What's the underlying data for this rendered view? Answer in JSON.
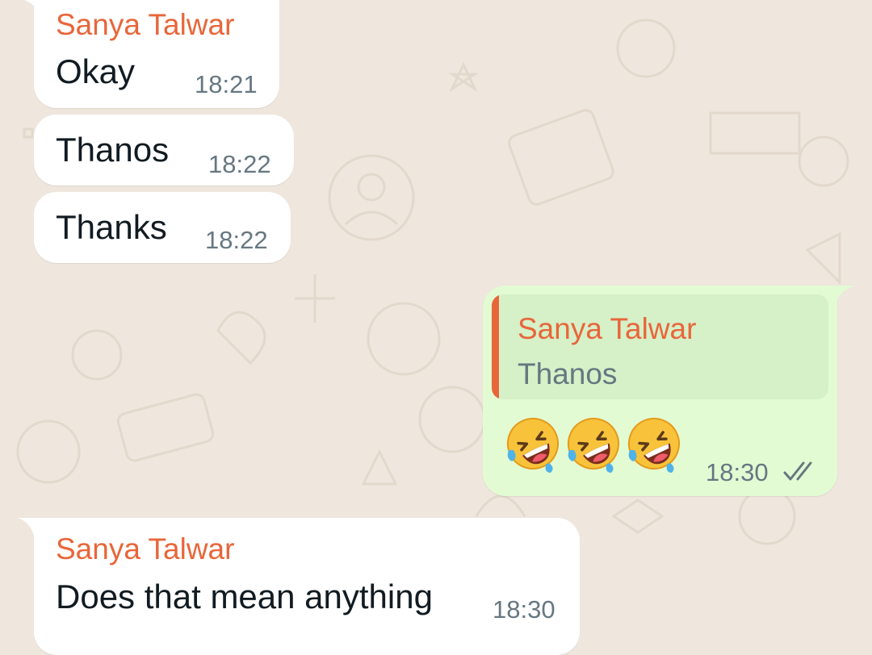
{
  "messages": [
    {
      "id": "m1",
      "direction": "incoming",
      "sender": "Sanya Talwar",
      "text": "Okay",
      "time": "18:21"
    },
    {
      "id": "m2",
      "direction": "incoming",
      "text": "Thanos",
      "time": "18:22"
    },
    {
      "id": "m3",
      "direction": "incoming",
      "text": "Thanks",
      "time": "18:22"
    },
    {
      "id": "m4",
      "direction": "outgoing",
      "quote": {
        "sender": "Sanya Talwar",
        "text": "Thanos"
      },
      "emojis": [
        "rolling-on-floor-laughing",
        "rolling-on-floor-laughing",
        "rolling-on-floor-laughing"
      ],
      "time": "18:30",
      "status": "read-double-tick"
    },
    {
      "id": "m5",
      "direction": "incoming",
      "sender": "Sanya Talwar",
      "text": "Does that mean anything",
      "time": "18:30"
    }
  ],
  "colors": {
    "wallpaper": "#efe6dd",
    "incoming_bubble": "#ffffff",
    "outgoing_bubble": "#e2fbd3",
    "sender_name": "#e8663a",
    "timestamp": "#667781",
    "message_text": "#111b21"
  }
}
